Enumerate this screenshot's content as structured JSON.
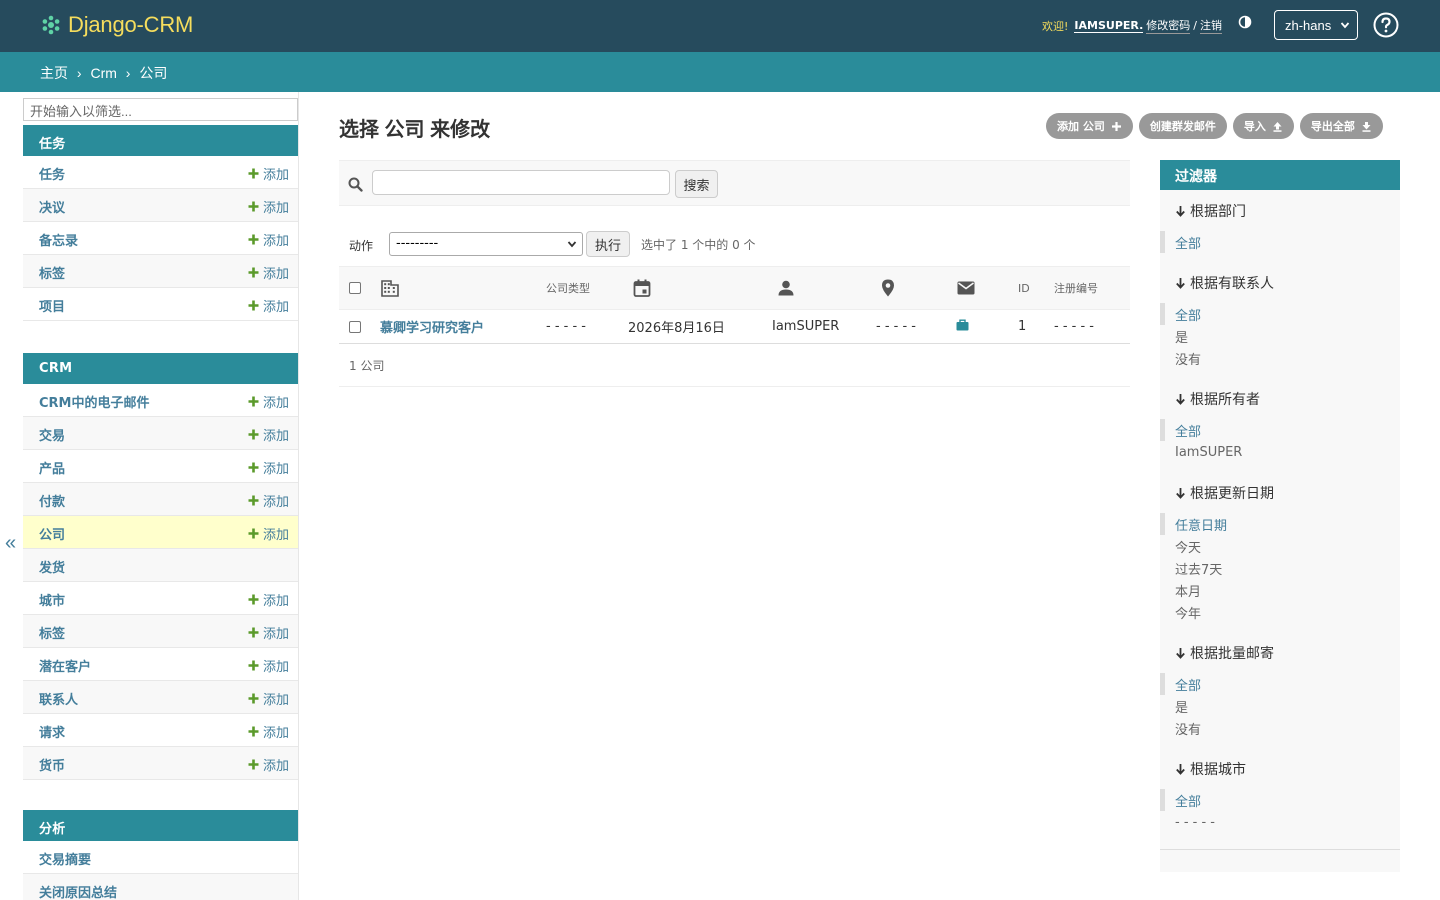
{
  "header": {
    "brand": "Django-CRM",
    "welcome": "欢迎!",
    "username": "IAMSUPER.",
    "change_password": "修改密码",
    "separator": "/",
    "logout": "注销",
    "language": "zh-hans",
    "brand_color": "#f5dd5d",
    "bg_color": "#264b5d"
  },
  "breadcrumbs": {
    "home": "主页",
    "app": "Crm",
    "current": "公司",
    "sep": "›"
  },
  "sidebar": {
    "filter_placeholder": "开始输入以筛选...",
    "modules": [
      {
        "caption": "任务",
        "rows": [
          {
            "label": "任务",
            "add": "添加"
          },
          {
            "label": "决议",
            "add": "添加"
          },
          {
            "label": "备忘录",
            "add": "添加"
          },
          {
            "label": "标签",
            "add": "添加"
          },
          {
            "label": "项目",
            "add": "添加"
          }
        ]
      },
      {
        "caption": "CRM",
        "rows": [
          {
            "label": "CRM中的电子邮件",
            "add": "添加"
          },
          {
            "label": "交易",
            "add": "添加"
          },
          {
            "label": "产品",
            "add": "添加"
          },
          {
            "label": "付款",
            "add": "添加"
          },
          {
            "label": "公司",
            "add": "添加"
          },
          {
            "label": "发货",
            "add": ""
          },
          {
            "label": "城市",
            "add": "添加"
          },
          {
            "label": "标签",
            "add": "添加"
          },
          {
            "label": "潜在客户",
            "add": "添加"
          },
          {
            "label": "联系人",
            "add": "添加"
          },
          {
            "label": "请求",
            "add": "添加"
          },
          {
            "label": "货币",
            "add": "添加"
          }
        ]
      },
      {
        "caption": "分析",
        "rows": [
          {
            "label": "交易摘要",
            "add": ""
          },
          {
            "label": "关闭原因总结",
            "add": ""
          }
        ]
      }
    ],
    "toggle": "«",
    "accent": "#2a8c9a",
    "link_color": "#447e9b",
    "add_color": "#5b9a2b",
    "current_bg": "#ffffcc"
  },
  "main": {
    "title": "选择 公司 来修改",
    "tools": {
      "add": "添加 公司",
      "mass_mail": "创建群发邮件",
      "import": "导入",
      "export": "导出全部"
    },
    "search_button": "搜索",
    "search_value": "",
    "actions_label": "动作",
    "action_selected": "---------",
    "go": "执行",
    "counter": "选中了 1 个中的 0 个",
    "columns": [
      "company-icon",
      "公司类型",
      "date-icon",
      "owner-icon",
      "location-icon",
      "mail-icon",
      "ID",
      "注册编号"
    ],
    "rows": [
      {
        "name": "慕卿学习研究客户",
        "type": "- - - - -",
        "date": "2026年8月16日",
        "owner": "IamSUPER",
        "location": "- - - - -",
        "mail": "briefcase-icon",
        "id": "1",
        "reg": "- - - - -"
      }
    ],
    "paginator": "1 公司"
  },
  "filter": {
    "title": "过滤器",
    "groups": [
      {
        "title": "根据部门",
        "options": [
          "全部"
        ]
      },
      {
        "title": "根据有联系人",
        "options": [
          "全部",
          "是",
          "没有"
        ]
      },
      {
        "title": "根据所有者",
        "options": [
          "全部",
          "IamSUPER"
        ]
      },
      {
        "title": "根据更新日期",
        "options": [
          "任意日期",
          "今天",
          "过去7天",
          "本月",
          "今年"
        ]
      },
      {
        "title": "根据批量邮寄",
        "options": [
          "全部",
          "是",
          "没有"
        ]
      },
      {
        "title": "根据城市",
        "options": [
          "全部",
          "- - - - -"
        ]
      }
    ]
  }
}
